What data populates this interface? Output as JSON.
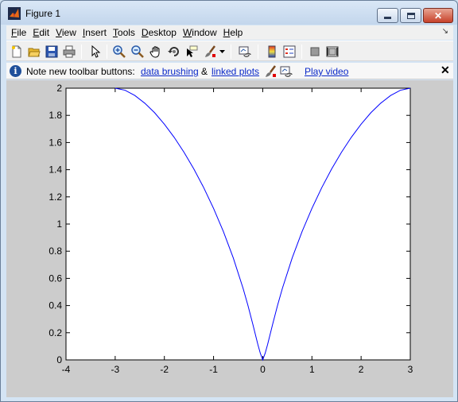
{
  "window": {
    "title": "Figure 1"
  },
  "menu": [
    {
      "key": "F",
      "rest": "ile"
    },
    {
      "key": "E",
      "rest": "dit"
    },
    {
      "key": "V",
      "rest": "iew"
    },
    {
      "key": "I",
      "rest": "nsert"
    },
    {
      "key": "T",
      "rest": "ools"
    },
    {
      "key": "D",
      "rest": "esktop"
    },
    {
      "key": "W",
      "rest": "indow"
    },
    {
      "key": "H",
      "rest": "elp"
    }
  ],
  "menu_dock_glyph": "↘",
  "toolbar": {
    "buttons": [
      "new-figure-icon",
      "open-file-icon",
      "save-icon",
      "print-icon",
      "edit-plot-arrow-icon",
      "zoom-in-icon",
      "zoom-out-icon",
      "pan-hand-icon",
      "rotate-3d-icon",
      "data-cursor-icon",
      "brush-icon",
      "brush-dropdown-icon",
      "link-plot-icon",
      "colorbar-icon",
      "legend-icon",
      "hide-plot-tools-icon",
      "show-plot-tools-icon"
    ]
  },
  "infobar": {
    "prefix": "Note new toolbar buttons:",
    "link1": "data brushing",
    "amp": "&",
    "link2": "linked plots",
    "video_link": "Play video",
    "close_glyph": "✕"
  },
  "chart_data": {
    "type": "line",
    "title": "",
    "xlabel": "",
    "ylabel": "",
    "xlim": [
      -4,
      3
    ],
    "ylim": [
      0,
      2
    ],
    "xticks": [
      "-4",
      "-3",
      "-2",
      "-1",
      "0",
      "1",
      "2",
      "3"
    ],
    "yticks": [
      "0",
      "0.2",
      "0.4",
      "0.6",
      "0.8",
      "1",
      "1.2",
      "1.4",
      "1.6",
      "1.8",
      "2"
    ],
    "grid": false,
    "series": [
      {
        "color": "#0000ff",
        "x": [
          -3,
          -2.8,
          -2.6,
          -2.4,
          -2.2,
          -2,
          -1.8,
          -1.6,
          -1.4,
          -1.2,
          -1,
          -0.8,
          -0.6,
          -0.4,
          -0.3,
          -0.2,
          -0.1,
          -0.05,
          0,
          0.05,
          0.1,
          0.2,
          0.3,
          0.4,
          0.6,
          0.8,
          1,
          1.2,
          1.4,
          1.6,
          1.8,
          2,
          2.2,
          2.4,
          2.6,
          2.8,
          3
        ],
        "y": [
          2,
          1.985,
          1.946,
          1.89,
          1.82,
          1.735,
          1.638,
          1.528,
          1.405,
          1.268,
          1.115,
          0.945,
          0.752,
          0.527,
          0.4,
          0.26,
          0.115,
          0.05,
          0,
          0.05,
          0.115,
          0.26,
          0.4,
          0.527,
          0.752,
          0.945,
          1.115,
          1.268,
          1.405,
          1.528,
          1.638,
          1.735,
          1.82,
          1.89,
          1.946,
          1.985,
          2
        ]
      }
    ]
  },
  "colors": {
    "plot_line": "#0000ff",
    "figure_bg": "#cccccc",
    "axes_bg": "#ffffff",
    "link": "#0a28c8"
  }
}
